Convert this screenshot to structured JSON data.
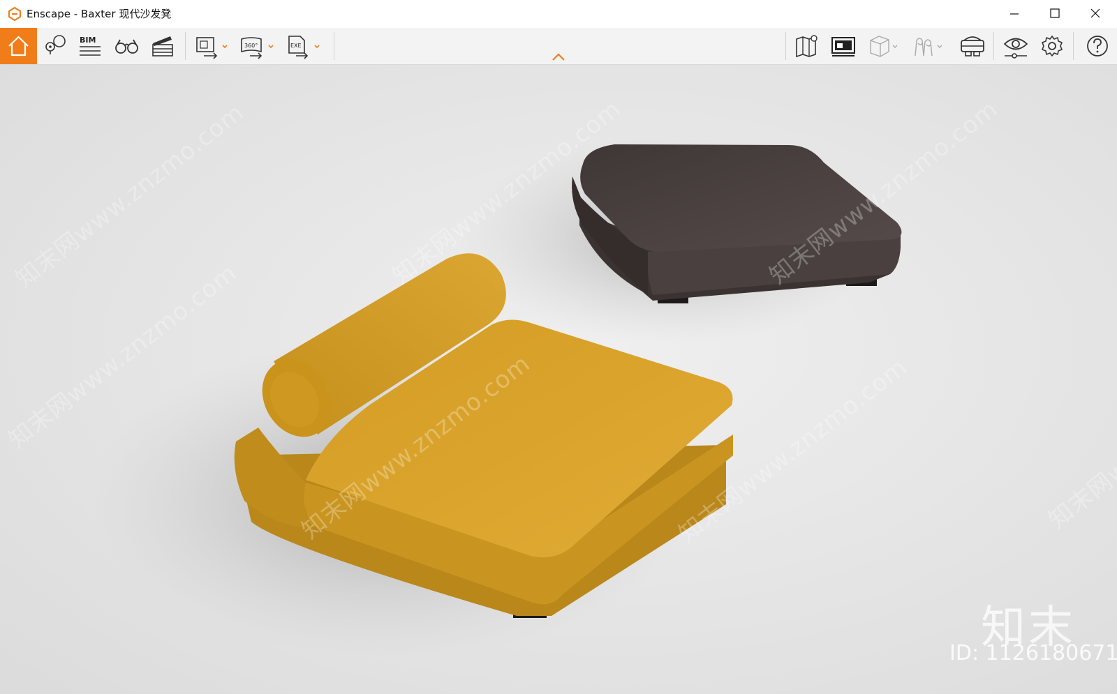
{
  "window": {
    "title": "Enscape - Baxter 现代沙发凳",
    "controls": [
      "minimize-icon",
      "maximize-icon",
      "close-icon"
    ]
  },
  "toolbar": {
    "accent_color": "#f07d1a",
    "left_tools": [
      {
        "name": "home",
        "icon": "home-icon",
        "active": true
      },
      {
        "name": "asset-library",
        "icon": "pin-icon"
      },
      {
        "name": "bim",
        "icon": "bim-icon",
        "label": "BIM"
      },
      {
        "name": "views",
        "icon": "binoculars-icon"
      },
      {
        "name": "video-editor",
        "icon": "clapperboard-icon"
      },
      {
        "name": "export-image",
        "icon": "export-image-icon",
        "has_dropdown": true
      },
      {
        "name": "export-panorama",
        "icon": "export-360-icon",
        "label": "360°",
        "has_dropdown": true
      },
      {
        "name": "export-exe",
        "icon": "export-exe-icon",
        "label": "EXE",
        "has_dropdown": true
      }
    ],
    "right_tools": [
      {
        "name": "map",
        "icon": "map-icon"
      },
      {
        "name": "screen-capture",
        "icon": "screen-icon"
      },
      {
        "name": "cube-view",
        "icon": "cube-icon",
        "has_dropdown": true
      },
      {
        "name": "materials",
        "icon": "materials-icon",
        "has_dropdown": true
      },
      {
        "name": "vr",
        "icon": "vr-headset-icon"
      },
      {
        "name": "visual-settings",
        "icon": "eye-icon"
      },
      {
        "name": "settings",
        "icon": "gear-icon"
      },
      {
        "name": "help",
        "icon": "help-icon"
      }
    ]
  },
  "viewport": {
    "background_color": "#ececec",
    "objects": [
      {
        "name": "yellow-sofa-chair",
        "color": "#d9a22a"
      },
      {
        "name": "dark-ottoman",
        "color": "#4b4140"
      }
    ],
    "watermark_text": "知末网www.znzmo.com",
    "watermark_logo": "知末",
    "watermark_id": "ID: 1126180671"
  }
}
